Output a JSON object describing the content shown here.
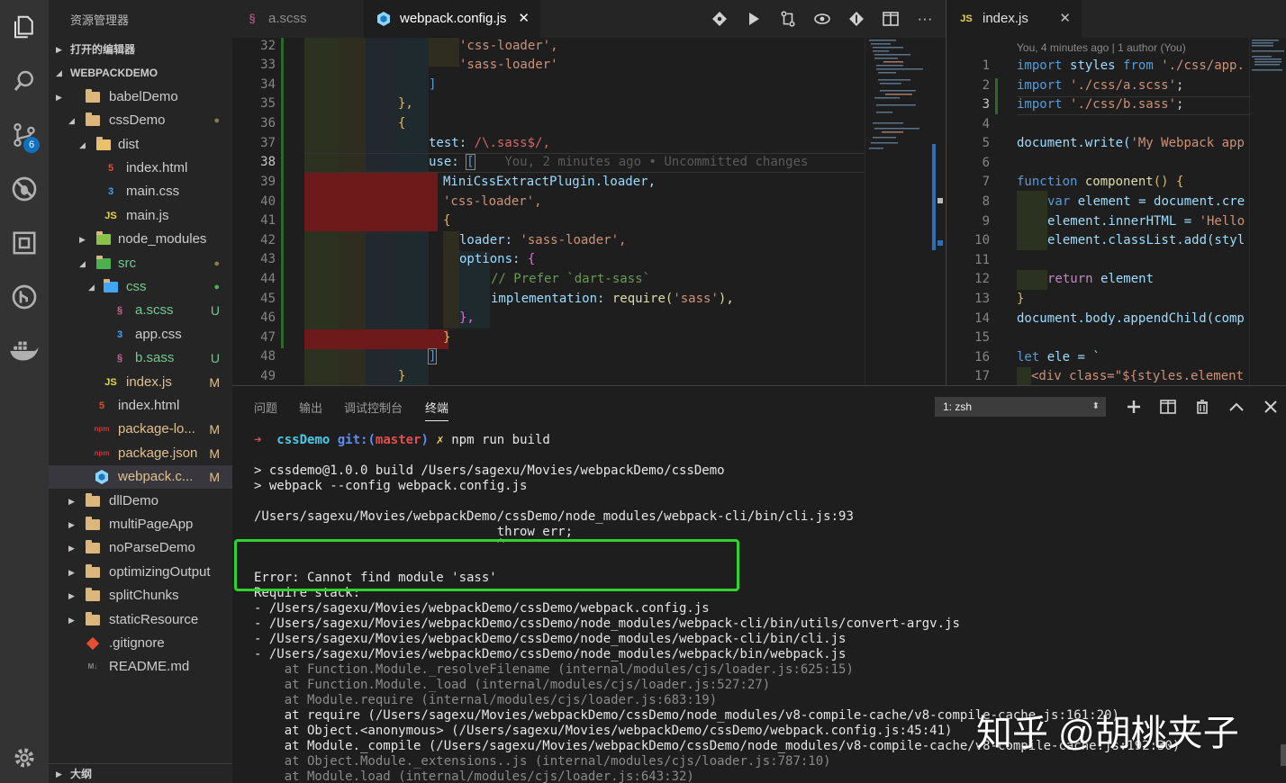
{
  "sidebar": {
    "title": "资源管理器",
    "open_editors": "打开的编辑器",
    "workspace": "WEBPACKDEMO",
    "outline": "大纲",
    "items": [
      {
        "name": "babelDemo",
        "status": ""
      },
      {
        "name": "cssDemo",
        "status": "●"
      },
      {
        "name": "dist",
        "status": ""
      },
      {
        "name": "index.html",
        "status": ""
      },
      {
        "name": "main.css",
        "status": ""
      },
      {
        "name": "main.js",
        "status": ""
      },
      {
        "name": "node_modules",
        "status": ""
      },
      {
        "name": "src",
        "status": "●"
      },
      {
        "name": "css",
        "status": "●"
      },
      {
        "name": "a.scss",
        "status": "U"
      },
      {
        "name": "app.css",
        "status": ""
      },
      {
        "name": "b.sass",
        "status": "U"
      },
      {
        "name": "index.js",
        "status": "M"
      },
      {
        "name": "index.html",
        "status": ""
      },
      {
        "name": "package-lo...",
        "status": "M"
      },
      {
        "name": "package.json",
        "status": "M"
      },
      {
        "name": "webpack.c...",
        "status": "M"
      },
      {
        "name": "dllDemo",
        "status": ""
      },
      {
        "name": "multiPageApp",
        "status": ""
      },
      {
        "name": "noParseDemo",
        "status": ""
      },
      {
        "name": "optimizingOutput",
        "status": ""
      },
      {
        "name": "splitChunks",
        "status": ""
      },
      {
        "name": "staticResource",
        "status": ""
      },
      {
        "name": ".gitignore",
        "status": ""
      },
      {
        "name": "README.md",
        "status": ""
      }
    ]
  },
  "activity": {
    "scm_badge": "6"
  },
  "tabs": [
    {
      "label": "a.scss"
    },
    {
      "label": "webpack.config.js"
    },
    {
      "label": "index.js"
    }
  ],
  "editor1": {
    "line_numbers": [
      "32",
      "33",
      "34",
      "35",
      "36",
      "37",
      "38",
      "39",
      "40",
      "41",
      "42",
      "43",
      "44",
      "45",
      "46",
      "47",
      "48",
      "49"
    ],
    "l32": "'css-loader',",
    "l33": "'sass-loader'",
    "l34": "]",
    "l35": "},",
    "l36": "{",
    "l37_key": "test:",
    "l37_val": "/\\.sass$/,",
    "l38_key": "use:",
    "l38_val": "[",
    "l38_blame": "You, 2 minutes ago • Uncommitted changes",
    "l39": "MiniCssExtractPlugin.loader,",
    "l40": "'css-loader',",
    "l41": "{",
    "l42_key": "loader:",
    "l42_val": "'sass-loader',",
    "l43_key": "options:",
    "l43_val": "{",
    "l44": "// Prefer `dart-sass`",
    "l45_key": "implementation:",
    "l45_fn": "require(",
    "l45_str": "'sass'",
    "l45_end": "),",
    "l46": "},",
    "l47": "}",
    "l48": "]",
    "l49": "}"
  },
  "editor2": {
    "blame": "You, 4 minutes ago | 1 author (You)",
    "line_numbers": [
      "1",
      "2",
      "3",
      "4",
      "5",
      "6",
      "7",
      "8",
      "9",
      "10",
      "11",
      "12",
      "13",
      "14",
      "15",
      "16",
      "17"
    ],
    "l1_kw": "import",
    "l1_id": "styles",
    "l1_from": "from",
    "l1_str": "'./css/app.",
    "l2_kw": "import",
    "l2_str": "'./css/a.scss'",
    "l2_end": ";",
    "l3_kw": "import",
    "l3_str": "'./css/b.sass'",
    "l3_end": ";",
    "l5_a": "document.write(",
    "l5_b": "'My Webpack app",
    "l7_kw": "function",
    "l7_fn": "component",
    "l7_end": "() {",
    "l8_kw": "var",
    "l8_rest": "element = document.cre",
    "l9_a": "element.innerHTML = ",
    "l9_b": "'Hello",
    "l10": "element.classList.add(styl",
    "l12_kw": "return",
    "l12_rest": "element",
    "l13": "}",
    "l14": "document.body.appendChild(comp",
    "l16_kw": "let",
    "l16_rest": "ele = `",
    "l17": "<div class=\"${styles.element"
  },
  "panel": {
    "tabs": [
      "问题",
      "输出",
      "调试控制台",
      "终端"
    ],
    "terminal_select": "1: zsh",
    "prompt_arrow": "➜",
    "prompt_dir": "cssDemo",
    "prompt_git": "git:(",
    "prompt_branch": "master",
    "prompt_git_end": ")",
    "prompt_x": "✗",
    "prompt_cmd": "npm run build",
    "lines": [
      "> cssdemo@1.0.0 build /Users/sagexu/Movies/webpackDemo/cssDemo",
      "> webpack --config webpack.config.js",
      "/Users/sagexu/Movies/webpackDemo/cssDemo/node_modules/webpack-cli/bin/cli.js:93",
      "                                throw err;",
      "                                ^",
      "Error: Cannot find module 'sass'",
      "Require stack:",
      "- /Users/sagexu/Movies/webpackDemo/cssDemo/webpack.config.js",
      "- /Users/sagexu/Movies/webpackDemo/cssDemo/node_modules/webpack-cli/bin/utils/convert-argv.js",
      "- /Users/sagexu/Movies/webpackDemo/cssDemo/node_modules/webpack-cli/bin/cli.js",
      "- /Users/sagexu/Movies/webpackDemo/cssDemo/node_modules/webpack/bin/webpack.js",
      "    at Function.Module._resolveFilename (internal/modules/cjs/loader.js:625:15)",
      "    at Function.Module._load (internal/modules/cjs/loader.js:527:27)",
      "    at Module.require (internal/modules/cjs/loader.js:683:19)",
      "    at require (/Users/sagexu/Movies/webpackDemo/cssDemo/node_modules/v8-compile-cache/v8-compile-cache.js:161:20)",
      "    at Object.<anonymous> (/Users/sagexu/Movies/webpackDemo/cssDemo/webpack.config.js:45:41)",
      "    at Module._compile (/Users/sagexu/Movies/webpackDemo/cssDemo/node_modules/v8-compile-cache/v8-compile-cache.js:192:30)",
      "    at Object.Module._extensions..js (internal/modules/cjs/loader.js:787:10)",
      "    at Module.load (internal/modules/cjs/loader.js:643:32)"
    ]
  },
  "watermark": "知乎 @胡桃夹子",
  "colors": {
    "accent": "#0e70c0",
    "highlight_box": "#2fd32f",
    "diff_removed": "#6e1a1a",
    "diff_added": "#2a6a2a"
  }
}
